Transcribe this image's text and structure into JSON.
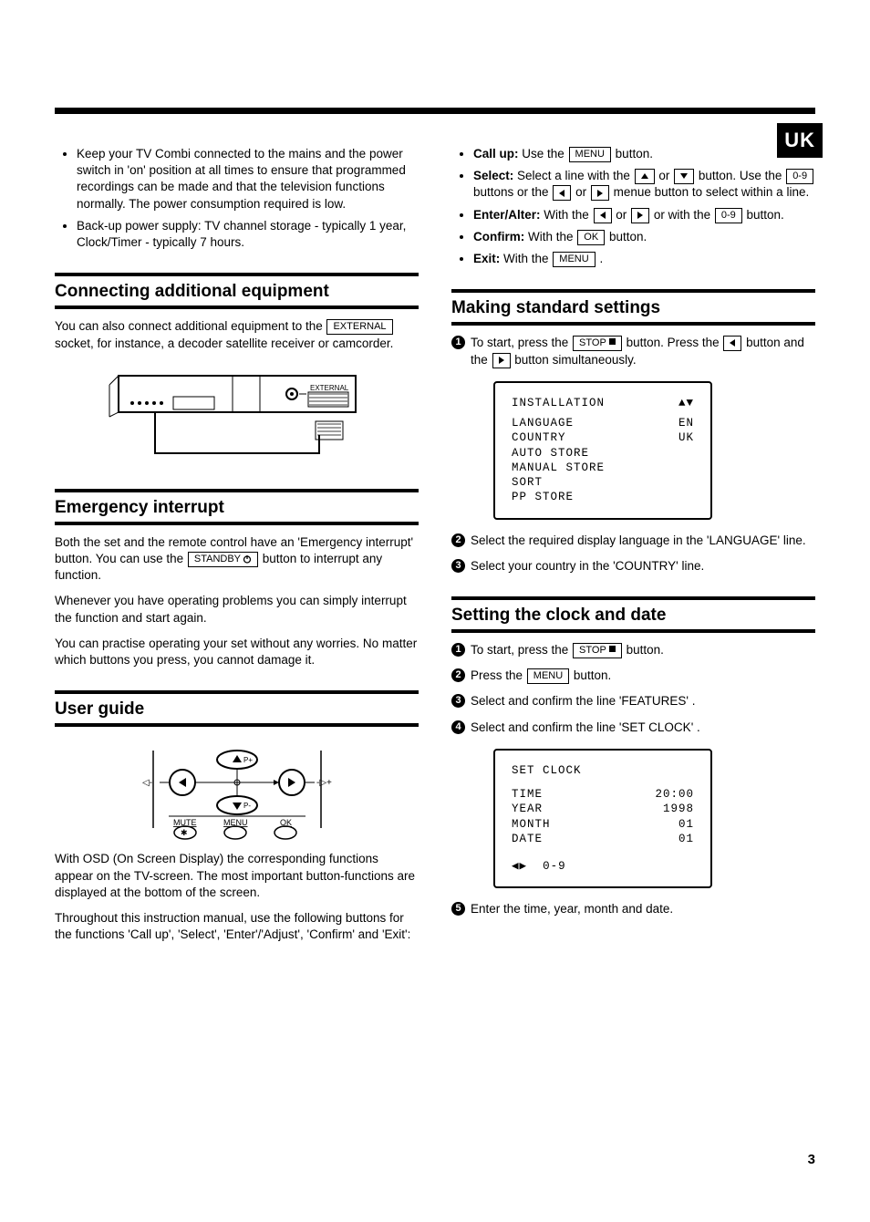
{
  "uk_tab": "UK",
  "page_number": "3",
  "left": {
    "intro_bullets": [
      "Keep your TV Combi connected to the mains and the power switch in 'on' position at all times to ensure that programmed recordings can be made and that the television functions normally. The power consumption required is low.",
      "Back-up power supply: TV channel storage - typically 1 year, Clock/Timer - typically 7 hours."
    ],
    "h_connect": "Connecting additional equipment",
    "connect_p1a": "You can also connect additional equipment to the ",
    "external_btn": "EXTERNAL",
    "connect_p1b": " socket, for instance, a decoder satellite receiver or camcorder.",
    "h_emergency": "Emergency interrupt",
    "em_p1a": "Both the set and the remote control have an 'Emergency interrupt' button. You can use the ",
    "standby_btn": "STANDBY",
    "em_p1b": " button to interrupt any function.",
    "em_p2": "Whenever you have operating problems you can simply interrupt the function and start again.",
    "em_p3": "You can practise operating your set without any worries. No matter which buttons you press, you cannot damage it.",
    "h_user": "User guide",
    "user_p1": "With OSD (On Screen Display) the corresponding functions appear on the TV-screen. The most important button-functions are displayed at the bottom of the screen.",
    "user_p2": "Throughout this instruction manual, use the following buttons for the functions 'Call up', 'Select', 'Enter'/'Adjust', 'Confirm' and 'Exit':",
    "remote_labels": {
      "mute": "MUTE",
      "menu": "MENU",
      "ok": "OK",
      "pplus": "P+",
      "pminus": "P-"
    }
  },
  "right": {
    "menu_btn": "MENU",
    "ok_btn": "OK",
    "stop_btn": "STOP",
    "numbers_btn": "0-9",
    "bl_callup_label": "Call up:",
    "bl_callup_a": " Use the ",
    "bl_callup_b": " button.",
    "bl_select_label": "Select:",
    "bl_select_a": " Select a line with the ",
    "bl_select_or": " or ",
    "bl_select_b": " button. Use the ",
    "bl_select_c": " buttons or the ",
    "bl_select_d": " menue button to select within a line.",
    "bl_enter_label": "Enter/Alter:",
    "bl_enter_a": " With the ",
    "bl_enter_b": " or with the ",
    "bl_enter_c": " button.",
    "bl_confirm_label": "Confirm:",
    "bl_confirm_a": " With the ",
    "bl_confirm_b": " button.",
    "bl_exit_label": "Exit:",
    "bl_exit_a": " With the ",
    "bl_exit_b": " .",
    "h_standard": "Making standard settings",
    "std_s1a": "To start, press the ",
    "std_s1b": " button. Press the ",
    "std_s1c": " button and the ",
    "std_s1d": " button simultaneously.",
    "osd1": {
      "title": "INSTALLATION",
      "nav": "▲▼",
      "rows": [
        {
          "l": "LANGUAGE",
          "r": "EN"
        },
        {
          "l": "COUNTRY",
          "r": "UK"
        },
        {
          "l": "AUTO STORE",
          "r": ""
        },
        {
          "l": "MANUAL STORE",
          "r": ""
        },
        {
          "l": "SORT",
          "r": ""
        },
        {
          "l": "PP STORE",
          "r": ""
        }
      ]
    },
    "std_s2": "Select the required display language in the 'LANGUAGE' line.",
    "std_s3": "Select your country in the 'COUNTRY' line.",
    "h_clock": "Setting the clock and date",
    "clk_s1a": "To start, press the ",
    "clk_s1b": " button.",
    "clk_s2a": "Press the ",
    "clk_s2b": " button.",
    "clk_s3": "Select and confirm the line 'FEATURES' .",
    "clk_s4": "Select and confirm the line 'SET CLOCK' .",
    "osd2": {
      "title": "SET CLOCK",
      "rows": [
        {
          "l": "TIME",
          "r": "20:00"
        },
        {
          "l": "YEAR",
          "r": "1998"
        },
        {
          "l": "MONTH",
          "r": "01"
        },
        {
          "l": "DATE",
          "r": "01"
        }
      ],
      "footer_nav": "◀▶",
      "footer_txt": "0-9"
    },
    "clk_s5": "Enter the time, year, month and date."
  }
}
